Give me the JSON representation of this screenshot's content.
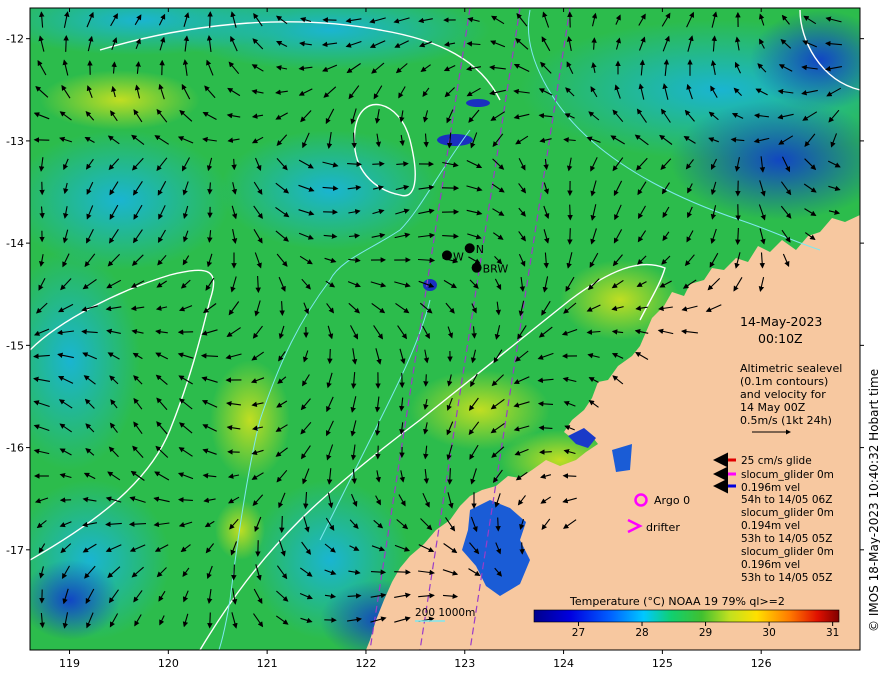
{
  "map": {
    "lon_range": [
      118.6,
      127.0
    ],
    "lat_range": [
      -17.98,
      -11.7
    ],
    "lon_ticks": [
      119,
      120,
      121,
      122,
      123,
      124,
      125,
      126
    ],
    "lat_ticks": [
      -12,
      -13,
      -14,
      -15,
      -16,
      -17
    ],
    "lon_tick_labels": [
      "119",
      "120",
      "121",
      "122",
      "123",
      "124",
      "125",
      "126"
    ],
    "lat_tick_labels": [
      "-12",
      "-13",
      "-14",
      "-15",
      "-16",
      "-17"
    ]
  },
  "timestamp": {
    "date": "14-May-2023",
    "time": "00:10Z"
  },
  "altimetry_note": {
    "line1": "Altimetric sealevel",
    "line2": "(0.1m contours)",
    "line3": "and velocity for",
    "line4": "14 May 00Z",
    "line5": "0.5m/s (1kt 24h)"
  },
  "stations": [
    {
      "label": "W",
      "lon": 122.82,
      "lat": -14.12
    },
    {
      "label": "N",
      "lon": 123.05,
      "lat": -14.05
    },
    {
      "label": "BRW",
      "lon": 123.12,
      "lat": -14.24
    }
  ],
  "glider_legend": {
    "entries": [
      {
        "color": "#e00000",
        "line1": "25 cm/s glide"
      },
      {
        "color": "#ff00ff",
        "line1": "slocum_glider 0m",
        "line2": "0.196m vel",
        "line3": "54h to 14/05 06Z"
      },
      {
        "color": "#0000dd",
        "line1": "slocum_glider 0m",
        "line2": "0.194m vel",
        "line3": "53h to 14/05 05Z"
      },
      {
        "color": "",
        "line1": "slocum_glider 0m",
        "line2": "0.196m vel",
        "line3": "53h to 14/05 05Z"
      }
    ]
  },
  "argo_label": "Argo 0",
  "drifter_label": "drifter",
  "isobath_label": "200  1000m",
  "colorbar": {
    "title": "Temperature (°C) NOAA 19 79% ql>=2",
    "min": 26.3,
    "max": 31.1,
    "ticks": [
      27,
      28,
      29,
      30,
      31
    ],
    "tick_labels": [
      "27",
      "28",
      "29",
      "30",
      "31"
    ]
  },
  "credit": "© IMOS 18-May-2023 10:40:32 Hobart time",
  "colors": {
    "land": "#f7c8a0",
    "sst_cool": "#1a5cd6",
    "sst_warm": "#38c038",
    "sst_hot": "#d8e818",
    "contour_ssh": "#ffffff",
    "isobath": "#7fe8f0",
    "track": "#9a3cc8",
    "arrow": "#000000",
    "argo": "#ff00ff"
  }
}
